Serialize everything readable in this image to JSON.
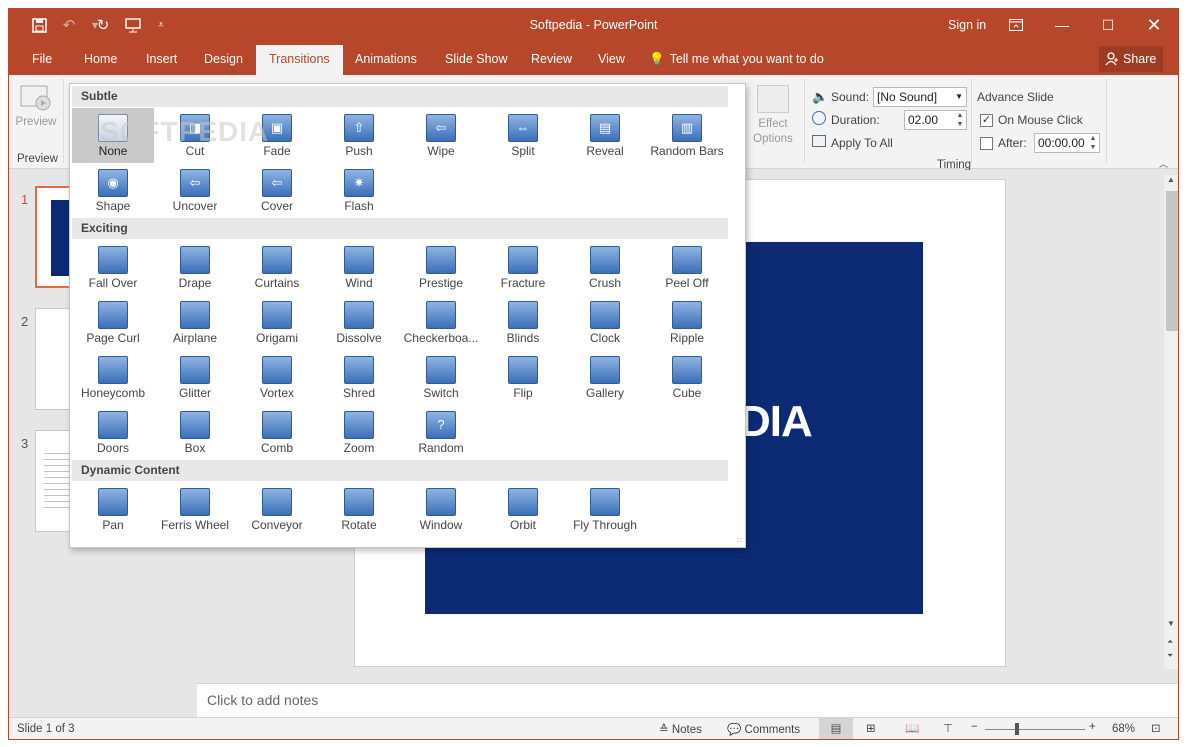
{
  "titlebar": {
    "title": "Softpedia - PowerPoint",
    "sign_in": "Sign in",
    "qat": [
      "save-icon",
      "undo-icon",
      "redo-icon",
      "start-from-beginning-icon",
      "customize-qat-icon"
    ]
  },
  "tabs": [
    "File",
    "Home",
    "Insert",
    "Design",
    "Transitions",
    "Animations",
    "Slide Show",
    "Review",
    "View"
  ],
  "tell_me": "Tell me what you want to do",
  "share": "Share",
  "ribbon": {
    "preview_label": "Preview",
    "preview_group": "Preview",
    "effect_options": "Effect Options",
    "sound_label": "Sound:",
    "sound_value": "[No Sound]",
    "duration_label": "Duration:",
    "duration_value": "02.00",
    "apply_to_all": "Apply To All",
    "advance_slide": "Advance Slide",
    "on_mouse_click": "On Mouse Click",
    "on_mouse_click_checked": true,
    "after_label": "After:",
    "after_value": "00:00.00",
    "after_checked": false,
    "timing_group": "Timing"
  },
  "gallery": {
    "watermark": "SOFTPEDIA",
    "sections": [
      {
        "name": "Subtle",
        "items": [
          "None",
          "Cut",
          "Fade",
          "Push",
          "Wipe",
          "Split",
          "Reveal",
          "Random Bars",
          "Shape",
          "Uncover",
          "Cover",
          "Flash"
        ]
      },
      {
        "name": "Exciting",
        "items": [
          "Fall Over",
          "Drape",
          "Curtains",
          "Wind",
          "Prestige",
          "Fracture",
          "Crush",
          "Peel Off",
          "Page Curl",
          "Airplane",
          "Origami",
          "Dissolve",
          "Checkerboa...",
          "Blinds",
          "Clock",
          "Ripple",
          "Honeycomb",
          "Glitter",
          "Vortex",
          "Shred",
          "Switch",
          "Flip",
          "Gallery",
          "Cube",
          "Doors",
          "Box",
          "Comb",
          "Zoom",
          "Random"
        ]
      },
      {
        "name": "Dynamic Content",
        "items": [
          "Pan",
          "Ferris Wheel",
          "Conveyor",
          "Rotate",
          "Window",
          "Orbit",
          "Fly Through"
        ]
      }
    ],
    "selected": "None"
  },
  "slides": {
    "numbers": [
      "1",
      "2",
      "3"
    ],
    "selected": "1"
  },
  "slide": {
    "text": "DIA",
    "block_color": "#0c2a74"
  },
  "notes_placeholder": "Click to add notes",
  "status": {
    "slide_of": "Slide 1 of 3",
    "notes": "Notes",
    "comments": "Comments",
    "zoom": "68%"
  },
  "colors": {
    "accent": "#b7472a",
    "ribbon": "#f3f3f3"
  }
}
